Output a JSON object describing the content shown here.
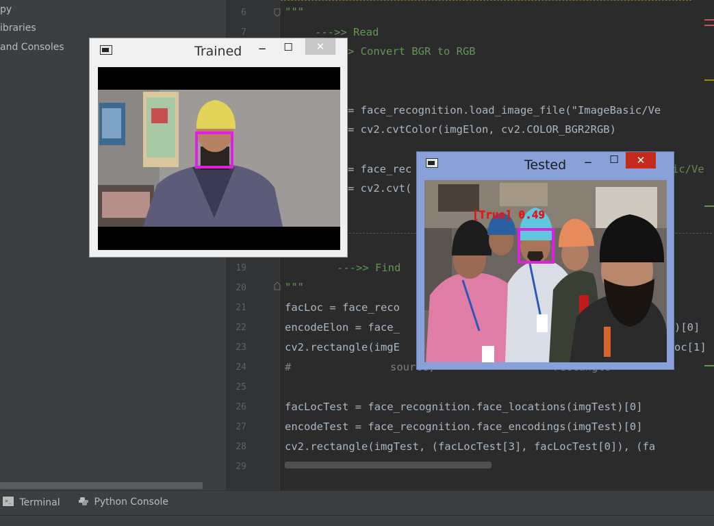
{
  "project_tree": {
    "items": [
      {
        "label": "py"
      },
      {
        "label": "ibraries"
      },
      {
        "label": "and Consoles"
      }
    ]
  },
  "editor": {
    "line_numbers": [
      "6",
      "7",
      "19",
      "20",
      "21",
      "22",
      "23",
      "24",
      "25",
      "26",
      "27",
      "28",
      "29"
    ],
    "lines": {
      "l6": "\"\"\"",
      "l7": "--->> Read",
      "l8": "> Convert BGR to RGB",
      "l11": "= face_recognition.load_image_file(\"ImageBasic/Ve",
      "l12": "= cv2.cvtColor(imgElon, cv2.COLOR_BGR2RGB)",
      "l14": "= face_rec",
      "l14b": "ic/Ve",
      "l15": "= cv2.cvt(",
      "l19": "--->> Find",
      "l20": "\"\"\"",
      "l21": "facLoc = face_reco",
      "l22": "encodeElon = face_",
      "l22b": ")[0]",
      "l23": "cv2.rectangle(imgE",
      "l23b": "oc[1]",
      "l24a": "#",
      "l24b": "source,",
      "l24c": "rectangle",
      "l26": "facLocTest = face_recognition.face_locations(imgTest)[0]",
      "l27": "encodeTest = face_recognition.face_encodings(imgTest)[0]",
      "l28": "cv2.rectangle(imgTest, (facLocTest[3], facLocTest[0]), (fa"
    }
  },
  "bottom_tools": {
    "terminal": "Terminal",
    "python_console": "Python Console"
  },
  "windows": {
    "trained": {
      "title": "Trained",
      "minimize": "−",
      "maximize": "☐",
      "close": "✕"
    },
    "tested": {
      "title": "Tested",
      "minimize": "−",
      "maximize": "☐",
      "close": "✕",
      "overlay_label": "[True] 0.49"
    }
  },
  "colors": {
    "face_box": "#e020e0",
    "overlay_text": "#e01818",
    "close_red": "#c42b1c",
    "tested_frame": "#8aa0d8",
    "trained_frame": "#f0f0f0"
  }
}
